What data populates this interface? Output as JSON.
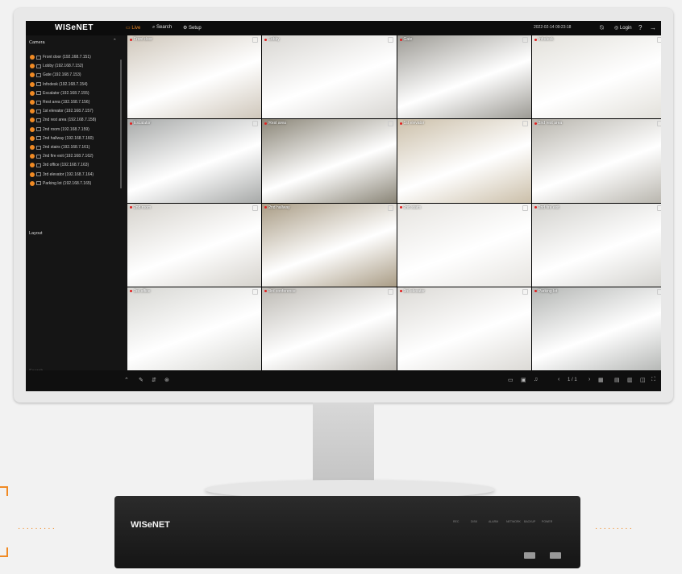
{
  "app": {
    "logo": "WISeNET"
  },
  "topbar": {
    "nav_live": "Live",
    "nav_search": "Search",
    "nav_setup": "Setup",
    "datetime": "2022-02-14 09:23:18",
    "login": "Login"
  },
  "sidebar": {
    "camera_heading": "Camera",
    "layout_heading": "Layout",
    "search_placeholder": "Search",
    "cameras": [
      "Front door (192.168.7.151)",
      "Lobby (192.168.7.152)",
      "Gate (192.168.7.153)",
      "Infodesk (192.168.7.154)",
      "Escalator (192.168.7.155)",
      "Rest area (192.168.7.156)",
      "1st elevator (192.168.7.157)",
      "2nd rest area (192.168.7.158)",
      "2nd room (192.168.7.159)",
      "2nd hallway (192.168.7.160)",
      "2nd stairs (192.168.7.161)",
      "2nd fire exit (192.168.7.162)",
      "3rd office (192.168.7.163)",
      "3rd elevator (192.168.7.164)",
      "Parking lot (192.168.7.165)"
    ]
  },
  "tiles": [
    {
      "label": "Front door",
      "bg": "#cfc7bb"
    },
    {
      "label": "Lobby",
      "bg": "#d8d6d2"
    },
    {
      "label": "Gate",
      "bg": "#9c9a94"
    },
    {
      "label": "Infodesk",
      "bg": "#e2e0da"
    },
    {
      "label": "Escalator",
      "bg": "#a7a9a8"
    },
    {
      "label": "Rest area",
      "bg": "#8a8577"
    },
    {
      "label": "1st elevator",
      "bg": "#cbbfa9"
    },
    {
      "label": "2nd rest area",
      "bg": "#b7b4ac"
    },
    {
      "label": "2nd room",
      "bg": "#d6d3cd"
    },
    {
      "label": "2nd hallway",
      "bg": "#a99c85"
    },
    {
      "label": "2nd stairs",
      "bg": "#e6e4e0"
    },
    {
      "label": "2nd fire exit",
      "bg": "#d3d2ce"
    },
    {
      "label": "3rd office",
      "bg": "#d7d7d3"
    },
    {
      "label": "3rd conference",
      "bg": "#bdbab4"
    },
    {
      "label": "3rd elevator",
      "bg": "#dcdad6"
    },
    {
      "label": "Parking lot",
      "bg": "#b4b6b4"
    }
  ],
  "bottombar": {
    "page": "1 / 1"
  },
  "nvr": {
    "logo": "WISeNET",
    "leds": [
      "REC",
      "DISK",
      "ALARM",
      "NETWORK",
      "BACKUP",
      "POWER"
    ]
  },
  "colors": {
    "accent": "#f08a24",
    "screen_bg": "#121212"
  }
}
